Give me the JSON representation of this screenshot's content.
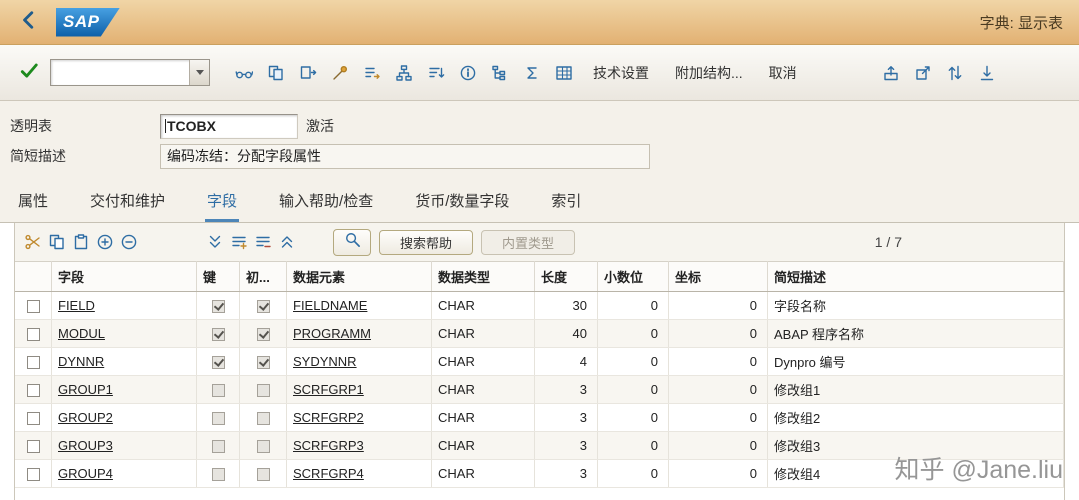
{
  "topbar": {
    "logo": "SAP",
    "title": "字典: 显示表"
  },
  "toolbar": {
    "command_value": "",
    "left_icons": [
      "glasses-icon",
      "copy-object-icon",
      "transport-icon",
      "activate-icon",
      "where-used-icon",
      "hierarchy-icon",
      "sort-icon",
      "info-icon",
      "tree-icon",
      "sum-icon",
      "grid-icon"
    ],
    "buttons": [
      {
        "name": "tech-settings-button",
        "label": "技术设置"
      },
      {
        "name": "append-structure-button",
        "label": "附加结构..."
      },
      {
        "name": "cancel-button",
        "label": "取消"
      }
    ],
    "right_icons": [
      "export-icon",
      "open-in-new-icon",
      "swap-icon",
      "download-icon"
    ]
  },
  "form": {
    "table_label": "透明表",
    "table_value": "TCOBX",
    "table_status": "激活",
    "desc_label": "简短描述",
    "desc_value": "编码冻结：分配字段属性"
  },
  "tabs": [
    {
      "id": "attributes",
      "label": "属性",
      "active": false
    },
    {
      "id": "delivery-maintenance",
      "label": "交付和维护",
      "active": false
    },
    {
      "id": "fields",
      "label": "字段",
      "active": true
    },
    {
      "id": "input-help-check",
      "label": "输入帮助/检查",
      "active": false
    },
    {
      "id": "currency-quantity",
      "label": "货币/数量字段",
      "active": false
    },
    {
      "id": "indexes",
      "label": "索引",
      "active": false
    }
  ],
  "table_toolbar": {
    "icons_group1": [
      "scissors-icon",
      "copy-icon",
      "paste-icon",
      "add-icon",
      "remove-icon"
    ],
    "icons_group2": [
      "page-down-icon",
      "insert-row-icon",
      "delete-row-icon",
      "page-up-icon"
    ],
    "buttons": [
      {
        "name": "search-help-button",
        "label": "搜索帮助",
        "disabled": false
      },
      {
        "name": "builtin-type-button",
        "label": "内置类型",
        "disabled": true
      }
    ],
    "pagination": "1 / 7"
  },
  "table": {
    "columns": [
      "字段",
      "键",
      "初...",
      "数据元素",
      "数据类型",
      "长度",
      "小数位",
      "坐标",
      "简短描述"
    ],
    "rows": [
      {
        "field": "FIELD",
        "key": true,
        "initial": true,
        "data_element": "FIELDNAME",
        "data_type": "CHAR",
        "length": "30",
        "decimals": "0",
        "coordinate": "0",
        "description": "字段名称"
      },
      {
        "field": "MODUL",
        "key": true,
        "initial": true,
        "data_element": "PROGRAMM",
        "data_type": "CHAR",
        "length": "40",
        "decimals": "0",
        "coordinate": "0",
        "description": "ABAP 程序名称"
      },
      {
        "field": "DYNNR",
        "key": true,
        "initial": true,
        "data_element": "SYDYNNR",
        "data_type": "CHAR",
        "length": "4",
        "decimals": "0",
        "coordinate": "0",
        "description": "Dynpro 编号"
      },
      {
        "field": "GROUP1",
        "key": false,
        "initial": false,
        "data_element": "SCRFGRP1",
        "data_type": "CHAR",
        "length": "3",
        "decimals": "0",
        "coordinate": "0",
        "description": "修改组1"
      },
      {
        "field": "GROUP2",
        "key": false,
        "initial": false,
        "data_element": "SCRFGRP2",
        "data_type": "CHAR",
        "length": "3",
        "decimals": "0",
        "coordinate": "0",
        "description": "修改组2"
      },
      {
        "field": "GROUP3",
        "key": false,
        "initial": false,
        "data_element": "SCRFGRP3",
        "data_type": "CHAR",
        "length": "3",
        "decimals": "0",
        "coordinate": "0",
        "description": "修改组3"
      },
      {
        "field": "GROUP4",
        "key": false,
        "initial": false,
        "data_element": "SCRFGRP4",
        "data_type": "CHAR",
        "length": "3",
        "decimals": "0",
        "coordinate": "0",
        "description": "修改组4"
      }
    ]
  },
  "watermark": "知乎 @Jane.liu",
  "colors": {
    "brand_blue": "#1b75c0",
    "topbar_tan": "#e8c48d",
    "active_tab_blue": "#2e6da4",
    "enter_green": "#1d8a1d"
  }
}
